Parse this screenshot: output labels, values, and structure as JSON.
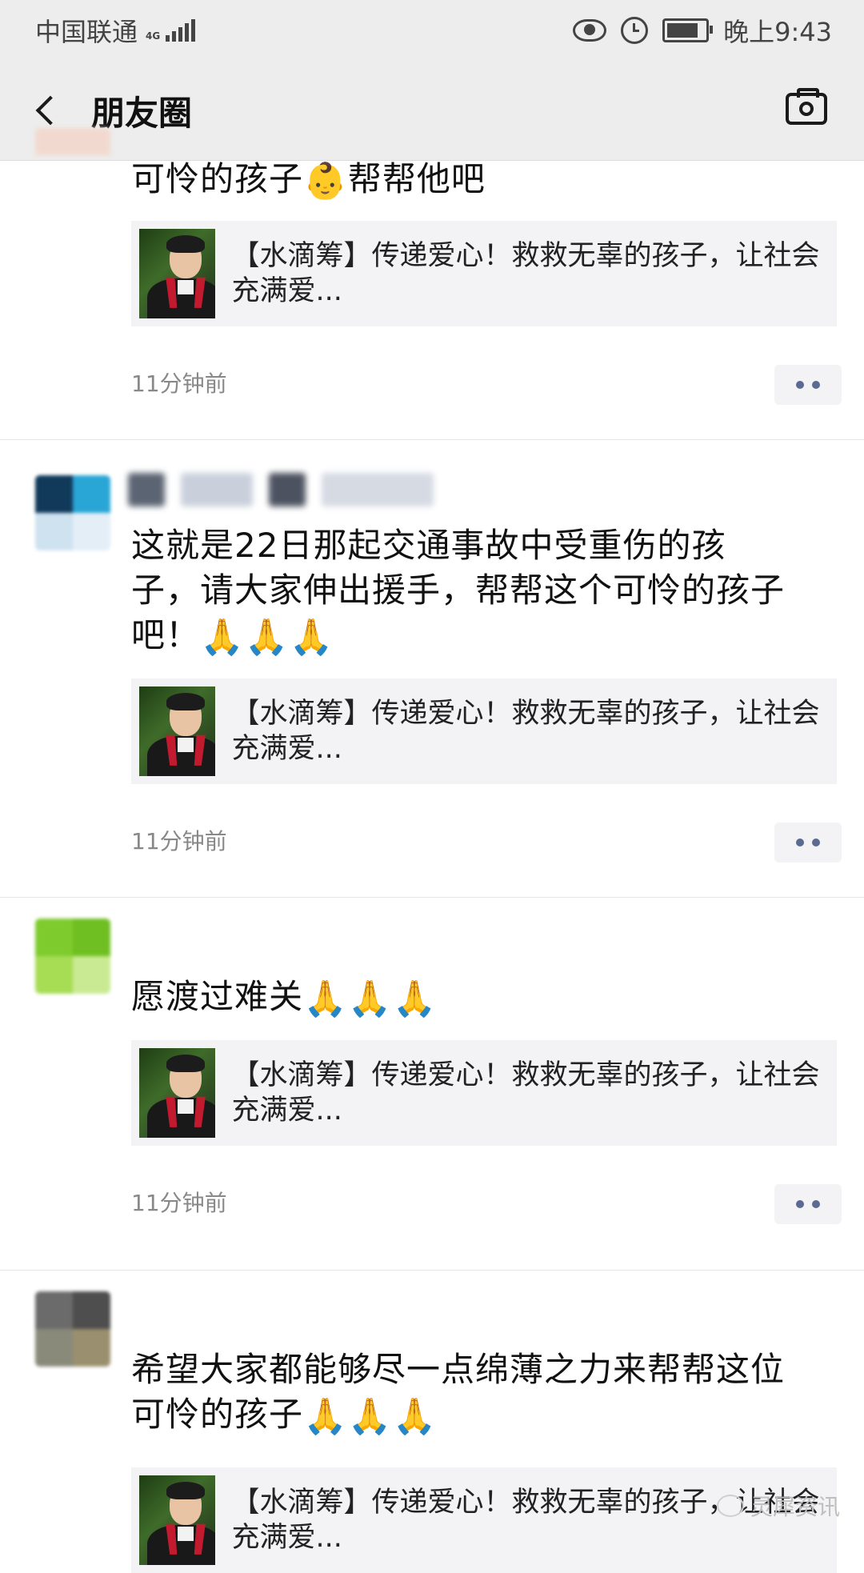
{
  "status_bar": {
    "carrier": "中国联通",
    "network": "4G",
    "time": "晚上9:43"
  },
  "nav": {
    "title": "朋友圈",
    "back_icon": "chevron-left-icon",
    "camera_icon": "camera-icon"
  },
  "posts": [
    {
      "text": "可怜的孩子",
      "emoji": "👶",
      "text_after_emoji": "帮帮他吧",
      "link_title": "【水滴筹】传递爱心！救救无辜的孩子，让社会充满爱...",
      "time": "11分钟前"
    },
    {
      "text": "这就是22日那起交通事故中受重伤的孩子，请大家伸出援手，帮帮这个可怜的孩子吧！",
      "emoji": "🙏🙏🙏",
      "link_title": "【水滴筹】传递爱心！救救无辜的孩子，让社会充满爱...",
      "time": "11分钟前"
    },
    {
      "text": "愿渡过难关",
      "emoji": "🙏🙏🙏",
      "link_title": "【水滴筹】传递爱心！救救无辜的孩子，让社会充满爱...",
      "time": "11分钟前"
    },
    {
      "text": "希望大家都能够尽一点绵薄之力来帮帮这位可怜的孩子",
      "emoji": "🙏🙏🙏",
      "link_title": "【水滴筹】传递爱心！救救无辜的孩子，让社会充满爱..."
    }
  ],
  "watermark": "灵犀资讯",
  "colors": {
    "header_bg": "#ededed",
    "link_card_bg": "#f3f3f5",
    "more_dots": "#5b6a91",
    "time_text": "#888888"
  }
}
